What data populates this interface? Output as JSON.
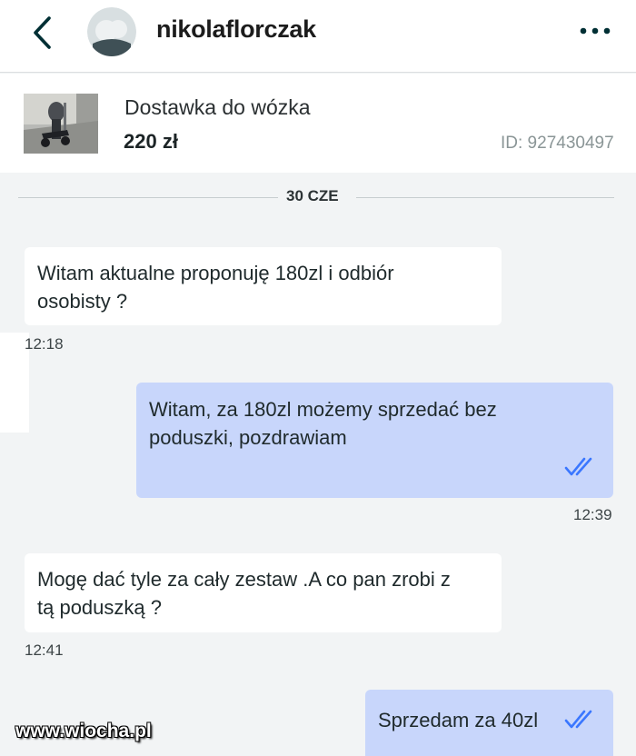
{
  "header": {
    "username": "nikolaflorczak",
    "back_icon": "chevron-left-icon",
    "more_icon": "more-horizontal-icon"
  },
  "listing": {
    "title": "Dostawka do wózka",
    "price": "220 zł",
    "id_text": "ID: 927430497"
  },
  "chat": {
    "date": "30 CZE",
    "messages": [
      {
        "direction": "incoming",
        "text_lines": [
          "Witam aktualne proponuję 180zl i odbiór",
          "osobisty ?"
        ],
        "time": "12:18"
      },
      {
        "direction": "outgoing",
        "text_lines": [
          "Witam, za 180zl możemy sprzedać bez",
          "poduszki, pozdrawiam"
        ],
        "time": "12:39",
        "read": true
      },
      {
        "direction": "incoming",
        "text_lines": [
          "Mogę dać tyle za cały zestaw .A co pan zrobi z",
          "tą poduszką ?"
        ],
        "time": "12:41"
      },
      {
        "direction": "outgoing",
        "text_lines": [
          "Sprzedam za 40zl"
        ],
        "read": true
      }
    ]
  },
  "watermark": "www.wiocha.pl",
  "colors": {
    "outgoing_bubble": "#c8d6fb",
    "incoming_bubble": "#ffffff",
    "chat_background": "#f2f4f5",
    "read_ticks": "#3a77ff"
  }
}
